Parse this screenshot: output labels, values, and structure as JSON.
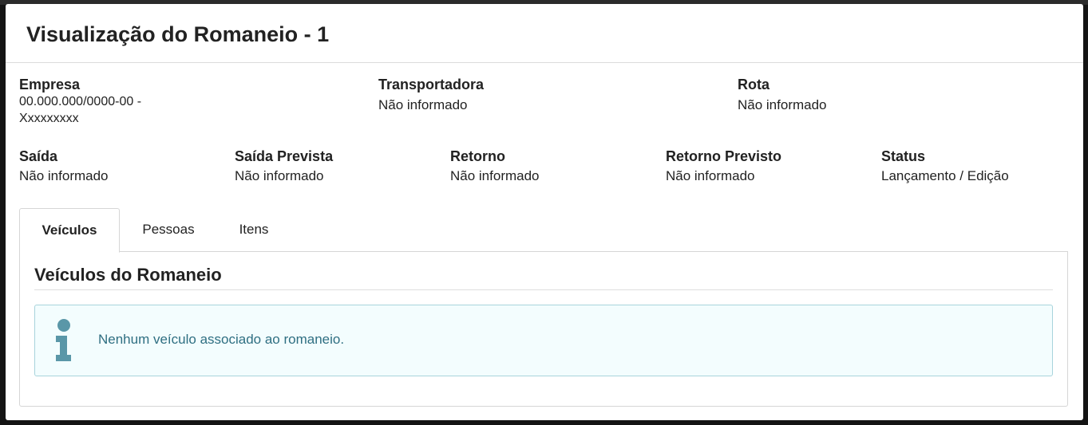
{
  "modal": {
    "title": "Visualização do Romaneio - 1"
  },
  "info_row1": {
    "empresa": {
      "label": "Empresa",
      "value_line1": "00.000.000/0000-00 -",
      "value_line2": "Xxxxxxxxx"
    },
    "transportadora": {
      "label": "Transportadora",
      "value": "Não informado"
    },
    "rota": {
      "label": "Rota",
      "value": "Não informado"
    }
  },
  "info_row2": {
    "saida": {
      "label": "Saída",
      "value": "Não informado"
    },
    "saida_prevista": {
      "label": "Saída Prevista",
      "value": "Não informado"
    },
    "retorno": {
      "label": "Retorno",
      "value": "Não informado"
    },
    "retorno_previsto": {
      "label": "Retorno Previsto",
      "value": "Não informado"
    },
    "status": {
      "label": "Status",
      "value": "Lançamento / Edição"
    }
  },
  "tabs": [
    {
      "label": "Veículos",
      "active": true
    },
    {
      "label": "Pessoas",
      "active": false
    },
    {
      "label": "Itens",
      "active": false
    }
  ],
  "panel": {
    "title": "Veículos do Romaneio",
    "alert": {
      "icon": "info-icon",
      "text": "Nenhum veículo associado ao romaneio."
    }
  },
  "colors": {
    "alert_bg": "#f3fdfe",
    "alert_border": "#a8d4dc",
    "alert_text": "#2f6f82",
    "info_icon": "#5a97a8"
  }
}
